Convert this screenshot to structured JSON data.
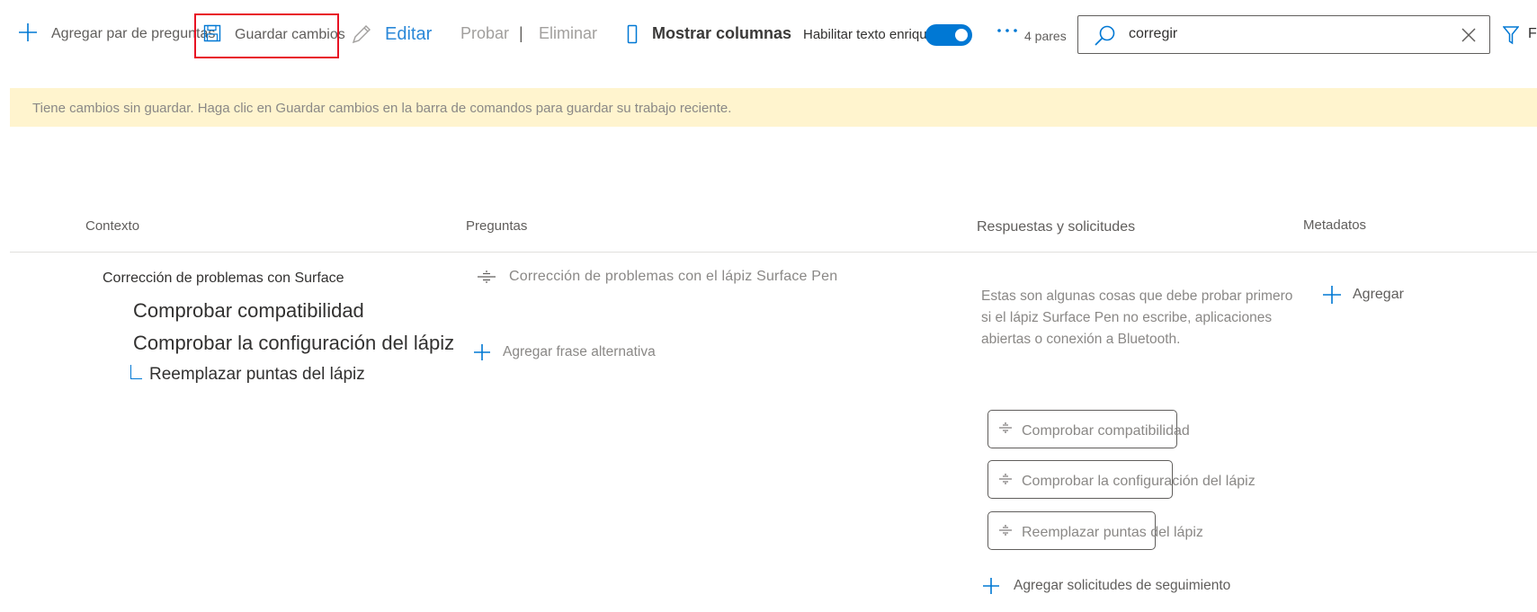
{
  "toolbar": {
    "add_pair": "Agregar par de preguntas",
    "save_changes": "Guardar cambios",
    "edit": "Editar",
    "test": "Probar",
    "separator": "|",
    "delete": "Eliminar",
    "show_columns": "Mostrar columnas",
    "rich_text": "Habilitar texto enriquecido",
    "rich_text_enabled": true,
    "pairs_count": "4 pares",
    "filter_partial": "F"
  },
  "search": {
    "value": "corregir"
  },
  "banner": {
    "text": "Tiene cambios sin guardar. Haga clic en Guardar cambios en la barra de comandos para guardar su trabajo reciente."
  },
  "columns": {
    "context": "Contexto",
    "questions": "Preguntas",
    "answers": "Respuestas y solicitudes",
    "metadata": "Metadatos"
  },
  "context": {
    "root": "Corrección de problemas con Surface",
    "children": [
      "Comprobar compatibilidad",
      "Comprobar la configuración del lápiz"
    ],
    "sub_child": "Reemplazar puntas del lápiz"
  },
  "questions": {
    "primary": "Corrección de problemas con el lápiz Surface Pen",
    "add_alternate": "Agregar frase alternativa"
  },
  "answer": {
    "text": "Estas son algunas cosas que debe probar primero si el lápiz Surface Pen no escribe, aplicaciones abiertas o conexión a Bluetooth.",
    "prompts": [
      "Comprobar compatibilidad",
      "Comprobar la configuración del lápiz",
      "Reemplazar puntas del lápiz"
    ],
    "add_followup": "Agregar solicitudes de seguimiento"
  },
  "metadata": {
    "add": "Agregar"
  },
  "colors": {
    "accent": "#0078d4",
    "banner_bg": "#fff4ce",
    "highlight": "#e81123"
  }
}
